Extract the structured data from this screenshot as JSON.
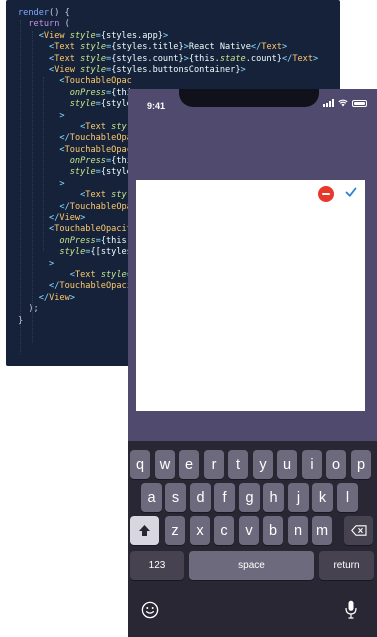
{
  "editor": {
    "lines": [
      [
        {
          "c": "fn",
          "t": "render"
        },
        {
          "c": "pu",
          "t": "() {"
        }
      ],
      [
        {
          "c": "pu",
          "t": "  "
        },
        {
          "c": "kw",
          "t": "return"
        },
        {
          "c": "pu",
          "t": " ("
        }
      ],
      [
        {
          "c": "pu",
          "t": "    "
        },
        {
          "c": "pl",
          "t": "<"
        },
        {
          "c": "tg",
          "t": "View"
        },
        {
          "c": "tx",
          "t": " "
        },
        {
          "c": "at",
          "t": "style"
        },
        {
          "c": "pl",
          "t": "="
        },
        {
          "c": "tx",
          "t": "{styles.app}"
        },
        {
          "c": "pl",
          "t": ">"
        }
      ],
      [
        {
          "c": "pu",
          "t": "      "
        },
        {
          "c": "pl",
          "t": "<"
        },
        {
          "c": "tg",
          "t": "Text"
        },
        {
          "c": "tx",
          "t": " "
        },
        {
          "c": "at",
          "t": "style"
        },
        {
          "c": "pl",
          "t": "="
        },
        {
          "c": "tx",
          "t": "{styles.title}"
        },
        {
          "c": "pl",
          "t": ">"
        },
        {
          "c": "tx",
          "t": "React Native"
        },
        {
          "c": "pl",
          "t": "</"
        },
        {
          "c": "tg",
          "t": "Text"
        },
        {
          "c": "pl",
          "t": ">"
        }
      ],
      [
        {
          "c": "pu",
          "t": "      "
        },
        {
          "c": "pl",
          "t": "<"
        },
        {
          "c": "tg",
          "t": "Text"
        },
        {
          "c": "tx",
          "t": " "
        },
        {
          "c": "at",
          "t": "style"
        },
        {
          "c": "pl",
          "t": "="
        },
        {
          "c": "tx",
          "t": "{styles.count}"
        },
        {
          "c": "pl",
          "t": ">"
        },
        {
          "c": "tx",
          "t": "{this."
        },
        {
          "c": "at",
          "t": "state"
        },
        {
          "c": "tx",
          "t": ".count}"
        },
        {
          "c": "pl",
          "t": "</"
        },
        {
          "c": "tg",
          "t": "Text"
        },
        {
          "c": "pl",
          "t": ">"
        }
      ],
      [
        {
          "c": "pu",
          "t": "      "
        },
        {
          "c": "pl",
          "t": "<"
        },
        {
          "c": "tg",
          "t": "View"
        },
        {
          "c": "tx",
          "t": " "
        },
        {
          "c": "at",
          "t": "style"
        },
        {
          "c": "pl",
          "t": "="
        },
        {
          "c": "tx",
          "t": "{styles.buttonsContainer}"
        },
        {
          "c": "pl",
          "t": ">"
        }
      ],
      [
        {
          "c": "pu",
          "t": "        "
        },
        {
          "c": "pl",
          "t": "<"
        },
        {
          "c": "tg",
          "t": "TouchableOpac"
        }
      ],
      [
        {
          "c": "pu",
          "t": "          "
        },
        {
          "c": "at",
          "t": "onPress"
        },
        {
          "c": "pl",
          "t": "="
        },
        {
          "c": "tx",
          "t": "{thi"
        }
      ],
      [
        {
          "c": "pu",
          "t": "          "
        },
        {
          "c": "at",
          "t": "style"
        },
        {
          "c": "pl",
          "t": "="
        },
        {
          "c": "tx",
          "t": "{style"
        }
      ],
      [
        {
          "c": "pu",
          "t": "        "
        },
        {
          "c": "pl",
          "t": ">"
        }
      ],
      [
        {
          "c": "pu",
          "t": "            "
        },
        {
          "c": "pl",
          "t": "<"
        },
        {
          "c": "tg",
          "t": "Text"
        },
        {
          "c": "tx",
          "t": " "
        },
        {
          "c": "at",
          "t": "styl"
        }
      ],
      [
        {
          "c": "pu",
          "t": "        "
        },
        {
          "c": "pl",
          "t": "</"
        },
        {
          "c": "tg",
          "t": "TouchableOpa"
        }
      ],
      [
        {
          "c": "pu",
          "t": "        "
        },
        {
          "c": "pl",
          "t": "<"
        },
        {
          "c": "tg",
          "t": "TouchableOpac"
        }
      ],
      [
        {
          "c": "pu",
          "t": "          "
        },
        {
          "c": "at",
          "t": "onPress"
        },
        {
          "c": "pl",
          "t": "="
        },
        {
          "c": "tx",
          "t": "{thi"
        }
      ],
      [
        {
          "c": "pu",
          "t": "          "
        },
        {
          "c": "at",
          "t": "style"
        },
        {
          "c": "pl",
          "t": "="
        },
        {
          "c": "tx",
          "t": "{style"
        }
      ],
      [
        {
          "c": "pu",
          "t": "        "
        },
        {
          "c": "pl",
          "t": ">"
        }
      ],
      [
        {
          "c": "pu",
          "t": "            "
        },
        {
          "c": "pl",
          "t": "<"
        },
        {
          "c": "tg",
          "t": "Text"
        },
        {
          "c": "tx",
          "t": " "
        },
        {
          "c": "at",
          "t": "styl"
        }
      ],
      [
        {
          "c": "pu",
          "t": "        "
        },
        {
          "c": "pl",
          "t": "</"
        },
        {
          "c": "tg",
          "t": "TouchableOpa"
        }
      ],
      [
        {
          "c": "pu",
          "t": "      "
        },
        {
          "c": "pl",
          "t": "</"
        },
        {
          "c": "tg",
          "t": "View"
        },
        {
          "c": "pl",
          "t": ">"
        }
      ],
      [
        {
          "c": "pu",
          "t": "      "
        },
        {
          "c": "pl",
          "t": "<"
        },
        {
          "c": "tg",
          "t": "TouchableOpacit"
        }
      ],
      [
        {
          "c": "pu",
          "t": "        "
        },
        {
          "c": "at",
          "t": "onPress"
        },
        {
          "c": "pl",
          "t": "="
        },
        {
          "c": "tx",
          "t": "{this."
        }
      ],
      [
        {
          "c": "pu",
          "t": "        "
        },
        {
          "c": "at",
          "t": "style"
        },
        {
          "c": "pl",
          "t": "="
        },
        {
          "c": "tx",
          "t": "{[styles"
        }
      ],
      [
        {
          "c": "pu",
          "t": "      "
        },
        {
          "c": "pl",
          "t": ">"
        }
      ],
      [
        {
          "c": "pu",
          "t": "          "
        },
        {
          "c": "pl",
          "t": "<"
        },
        {
          "c": "tg",
          "t": "Text"
        },
        {
          "c": "tx",
          "t": " "
        },
        {
          "c": "at",
          "t": "style"
        },
        {
          "c": "pl",
          "t": "="
        }
      ],
      [
        {
          "c": "pu",
          "t": "      "
        },
        {
          "c": "pl",
          "t": "</"
        },
        {
          "c": "tg",
          "t": "TouchableOpaci"
        }
      ],
      [
        {
          "c": "pu",
          "t": "    "
        },
        {
          "c": "pl",
          "t": "</"
        },
        {
          "c": "tg",
          "t": "View"
        },
        {
          "c": "pl",
          "t": ">"
        }
      ],
      [
        {
          "c": "pu",
          "t": "  );"
        }
      ],
      [
        {
          "c": "pu",
          "t": "}"
        }
      ]
    ]
  },
  "phone": {
    "time": "9:41",
    "icons": [
      "signal-icon",
      "wifi-icon",
      "battery-icon"
    ],
    "card": {
      "buttons": [
        "remove-icon",
        "checkmark-icon"
      ],
      "colors": {
        "remove": "#e8382b",
        "check": "#2f80d6"
      }
    }
  },
  "keyboard": {
    "row1": [
      "q",
      "w",
      "e",
      "r",
      "t",
      "y",
      "u",
      "i",
      "o",
      "p"
    ],
    "row2": [
      "a",
      "s",
      "d",
      "f",
      "g",
      "h",
      "j",
      "k",
      "l"
    ],
    "row3": [
      "z",
      "x",
      "c",
      "v",
      "b",
      "n",
      "m"
    ],
    "numbers_label": "123",
    "space_label": "space",
    "return_label": "return",
    "icons": [
      "shift-icon",
      "backspace-icon",
      "emoji-icon",
      "microphone-icon"
    ]
  }
}
